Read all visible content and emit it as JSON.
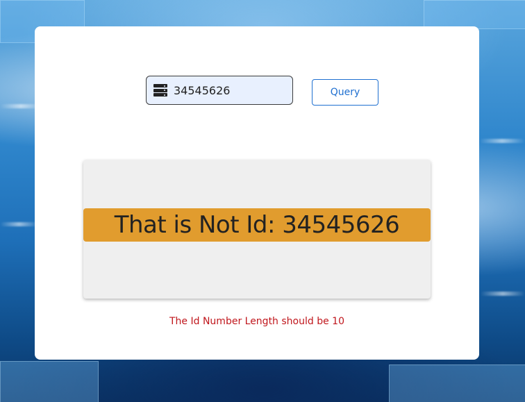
{
  "search": {
    "value": "34545626",
    "icon": "server-icon"
  },
  "query_button": {
    "label": "Query",
    "color": "#1e6fd0"
  },
  "result": {
    "text": "That is Not Id: 34545626",
    "banner_color": "#e19c2e"
  },
  "error": {
    "message": "The Id Number Length should be 10",
    "color": "#c0161c"
  }
}
